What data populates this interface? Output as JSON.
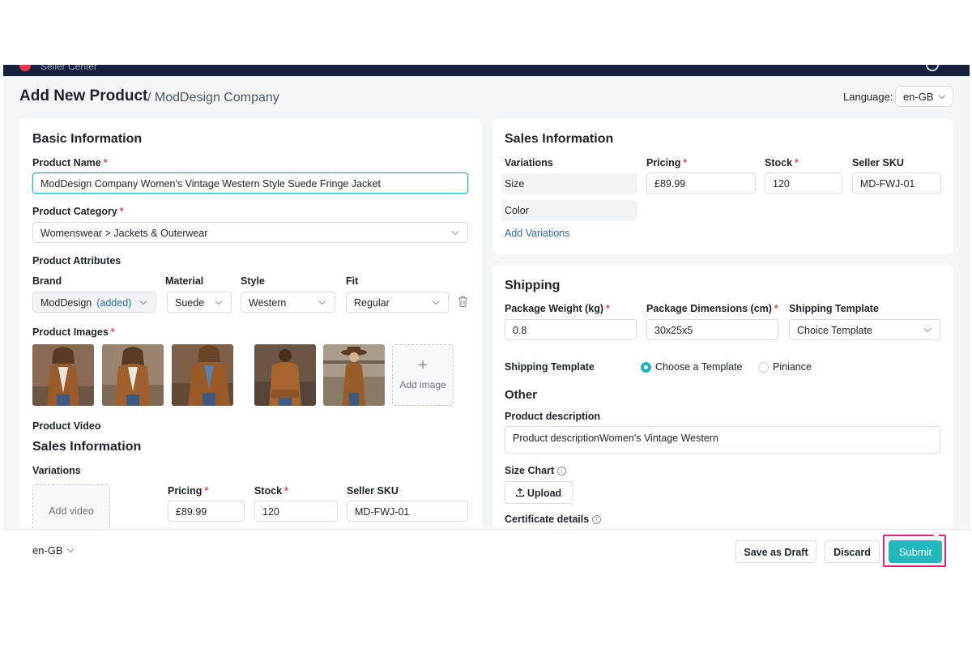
{
  "topbar": {
    "brand": "Seller Center"
  },
  "header": {
    "title": "Add New Product",
    "separator": "/",
    "company": "ModDesign Company",
    "language_label": "Language:",
    "language_value": "en-GB"
  },
  "basic": {
    "title": "Basic Information",
    "product_name_label": "Product Name",
    "product_name_value": "ModDesign Company Women's Vintage Western Style Suede Fringe Jacket",
    "category_label": "Product Category",
    "category_value": "Womenswear > Jackets & Outerwear",
    "attributes_label": "Product Attributes",
    "attributes": {
      "brand_label": "Brand",
      "brand_value": "ModDesign",
      "brand_added": "(added)",
      "material_label": "Material",
      "material_value": "Suede",
      "style_label": "Style",
      "style_value": "Western",
      "fit_label": "Fit",
      "fit_value": "Regular"
    },
    "images_label": "Product Images",
    "add_image_label": "Add image",
    "video_label": "Product Video",
    "add_video_label": "Add video",
    "sales_title": "Sales Information",
    "variations_label": "Variations",
    "pricing_label": "Pricing",
    "pricing_value": "£89.99",
    "stock_label": "Stock",
    "stock_value": "120",
    "sku_label": "Seller SKU",
    "sku_value": "MD-FWJ-01"
  },
  "sales": {
    "title": "Sales Information",
    "variations_label": "Variations",
    "pricing_label": "Pricing",
    "stock_label": "Stock",
    "sku_label": "Seller SKU",
    "rows": [
      {
        "name": "Size",
        "price": "£89.99",
        "stock": "120",
        "sku": "MD-FWJ-01"
      },
      {
        "name": "Color"
      }
    ],
    "add_variations": "Add Variations"
  },
  "shipping": {
    "title": "Shipping",
    "weight_label": "Package Weight (kg)",
    "weight_value": "0.8",
    "dimensions_label": "Package Dimensions (cm)",
    "dimensions_value": "30x25x5",
    "template_label": "Shipping Template",
    "template_value": "Choice Template",
    "template_row_label": "Shipping Template",
    "radio_options": [
      "Choose a Template",
      "Piniance"
    ],
    "other_title": "Other",
    "description_label": "Product description",
    "description_value": "Product descriptionWomen's Vintage Western",
    "size_chart_label": "Size Chart",
    "upload_label": "Upload",
    "certificate_label": "Certificate details"
  },
  "footer": {
    "language": "en-GB",
    "save_draft": "Save as Draft",
    "discard": "Discard",
    "submit": "Submit"
  },
  "colors": {
    "accent": "#22b8be",
    "highlight": "#e6237a",
    "required": "#e5484d",
    "link": "#2b6cb0"
  }
}
